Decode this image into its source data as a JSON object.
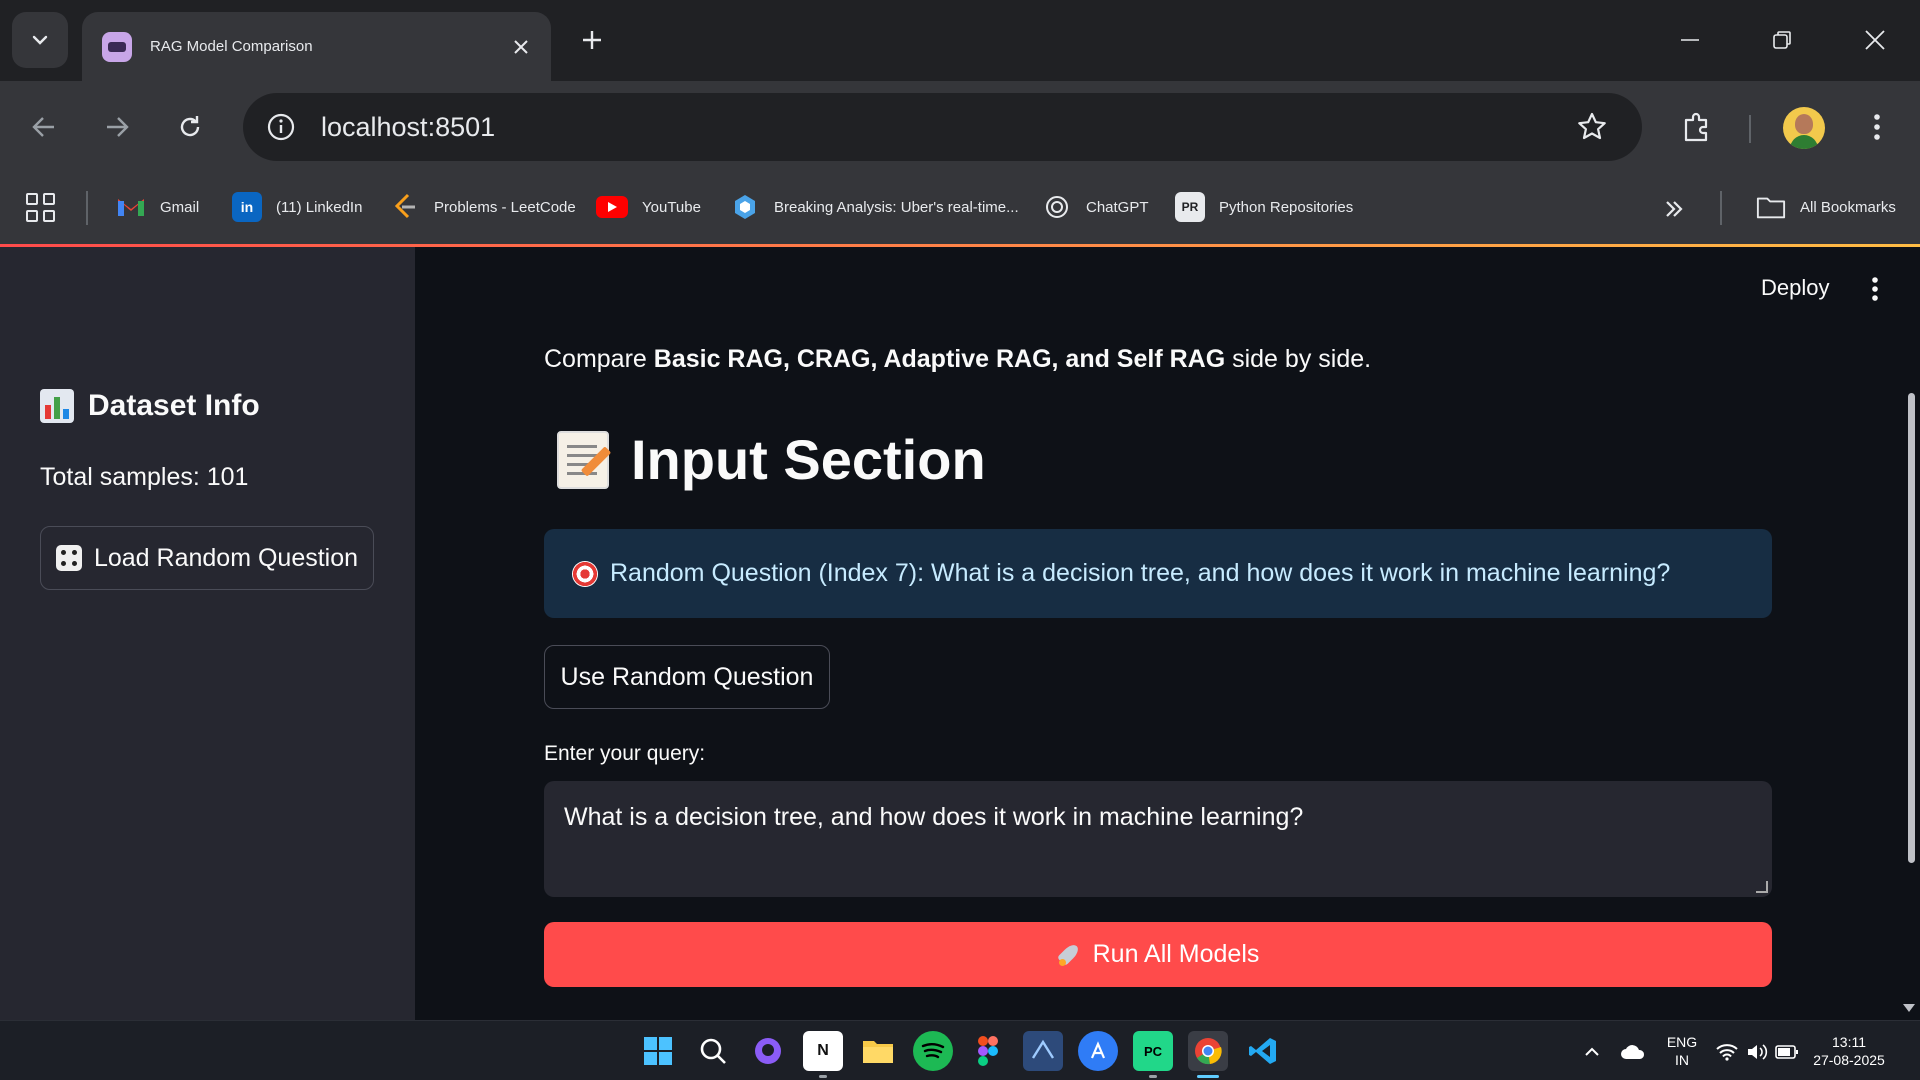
{
  "browser": {
    "tab_title": "RAG Model Comparison",
    "url": "localhost:8501",
    "bookmarks": [
      {
        "label": "Gmail",
        "icon": "gmail-icon"
      },
      {
        "label": "(11) LinkedIn",
        "icon": "linkedin-icon"
      },
      {
        "label": "Problems - LeetCode",
        "icon": "leetcode-icon"
      },
      {
        "label": "YouTube",
        "icon": "youtube-icon"
      },
      {
        "label": "Breaking Analysis: Uber's real-time...",
        "icon": "article-icon"
      },
      {
        "label": "ChatGPT",
        "icon": "chatgpt-icon"
      },
      {
        "label": "Python Repositories",
        "icon": "python-repo-icon"
      }
    ],
    "all_bookmarks": "All Bookmarks"
  },
  "sidebar": {
    "dataset_header": "Dataset Info",
    "total_samples": "Total samples: 101",
    "load_button": "Load Random Question"
  },
  "main": {
    "deploy": "Deploy",
    "intro": {
      "prefix": "Compare ",
      "bold": "Basic RAG, CRAG, Adaptive RAG, and Self RAG",
      "suffix": " side by side."
    },
    "section_title": "Input Section",
    "info_message": "Random Question (Index 7): What is a decision tree, and how does it work in machine learning?",
    "use_random_button": "Use Random Question",
    "query_label": "Enter your query:",
    "query_value": "What is a decision tree, and how does it work in machine learning?",
    "run_button": "Run All Models"
  },
  "taskbar": {
    "language": "ENG",
    "region": "IN",
    "time": "13:11",
    "date": "27-08-2025"
  },
  "colors": {
    "app_bg": "#0e1117",
    "sidebar_bg": "#262730",
    "info_bg": "#172d43",
    "primary": "#ff4b4b"
  }
}
